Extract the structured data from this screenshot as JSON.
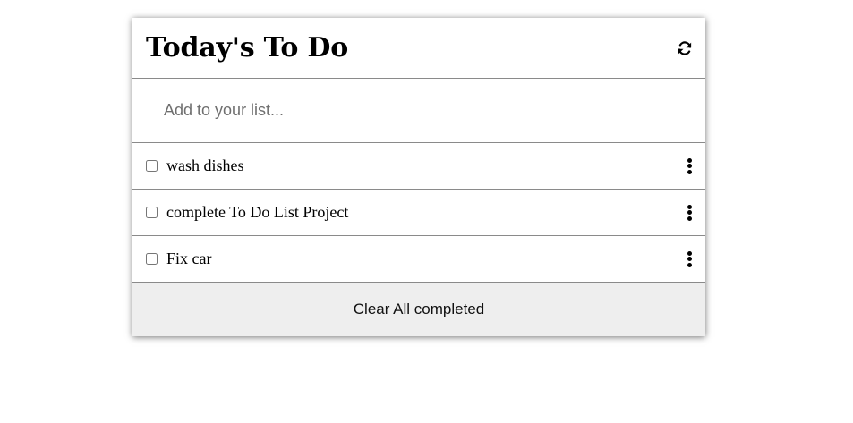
{
  "header": {
    "title": "Today's To Do",
    "refresh_icon": "refresh-icon"
  },
  "add_input": {
    "placeholder": "Add to your list...",
    "value": ""
  },
  "todos": [
    {
      "text": "wash dishes",
      "checked": false
    },
    {
      "text": "complete To Do List Project",
      "checked": false
    },
    {
      "text": "Fix car",
      "checked": false
    }
  ],
  "footer": {
    "clear_label": "Clear All completed"
  },
  "colors": {
    "footer_bg": "#eeeeee",
    "divider": "#8a8a8a"
  }
}
